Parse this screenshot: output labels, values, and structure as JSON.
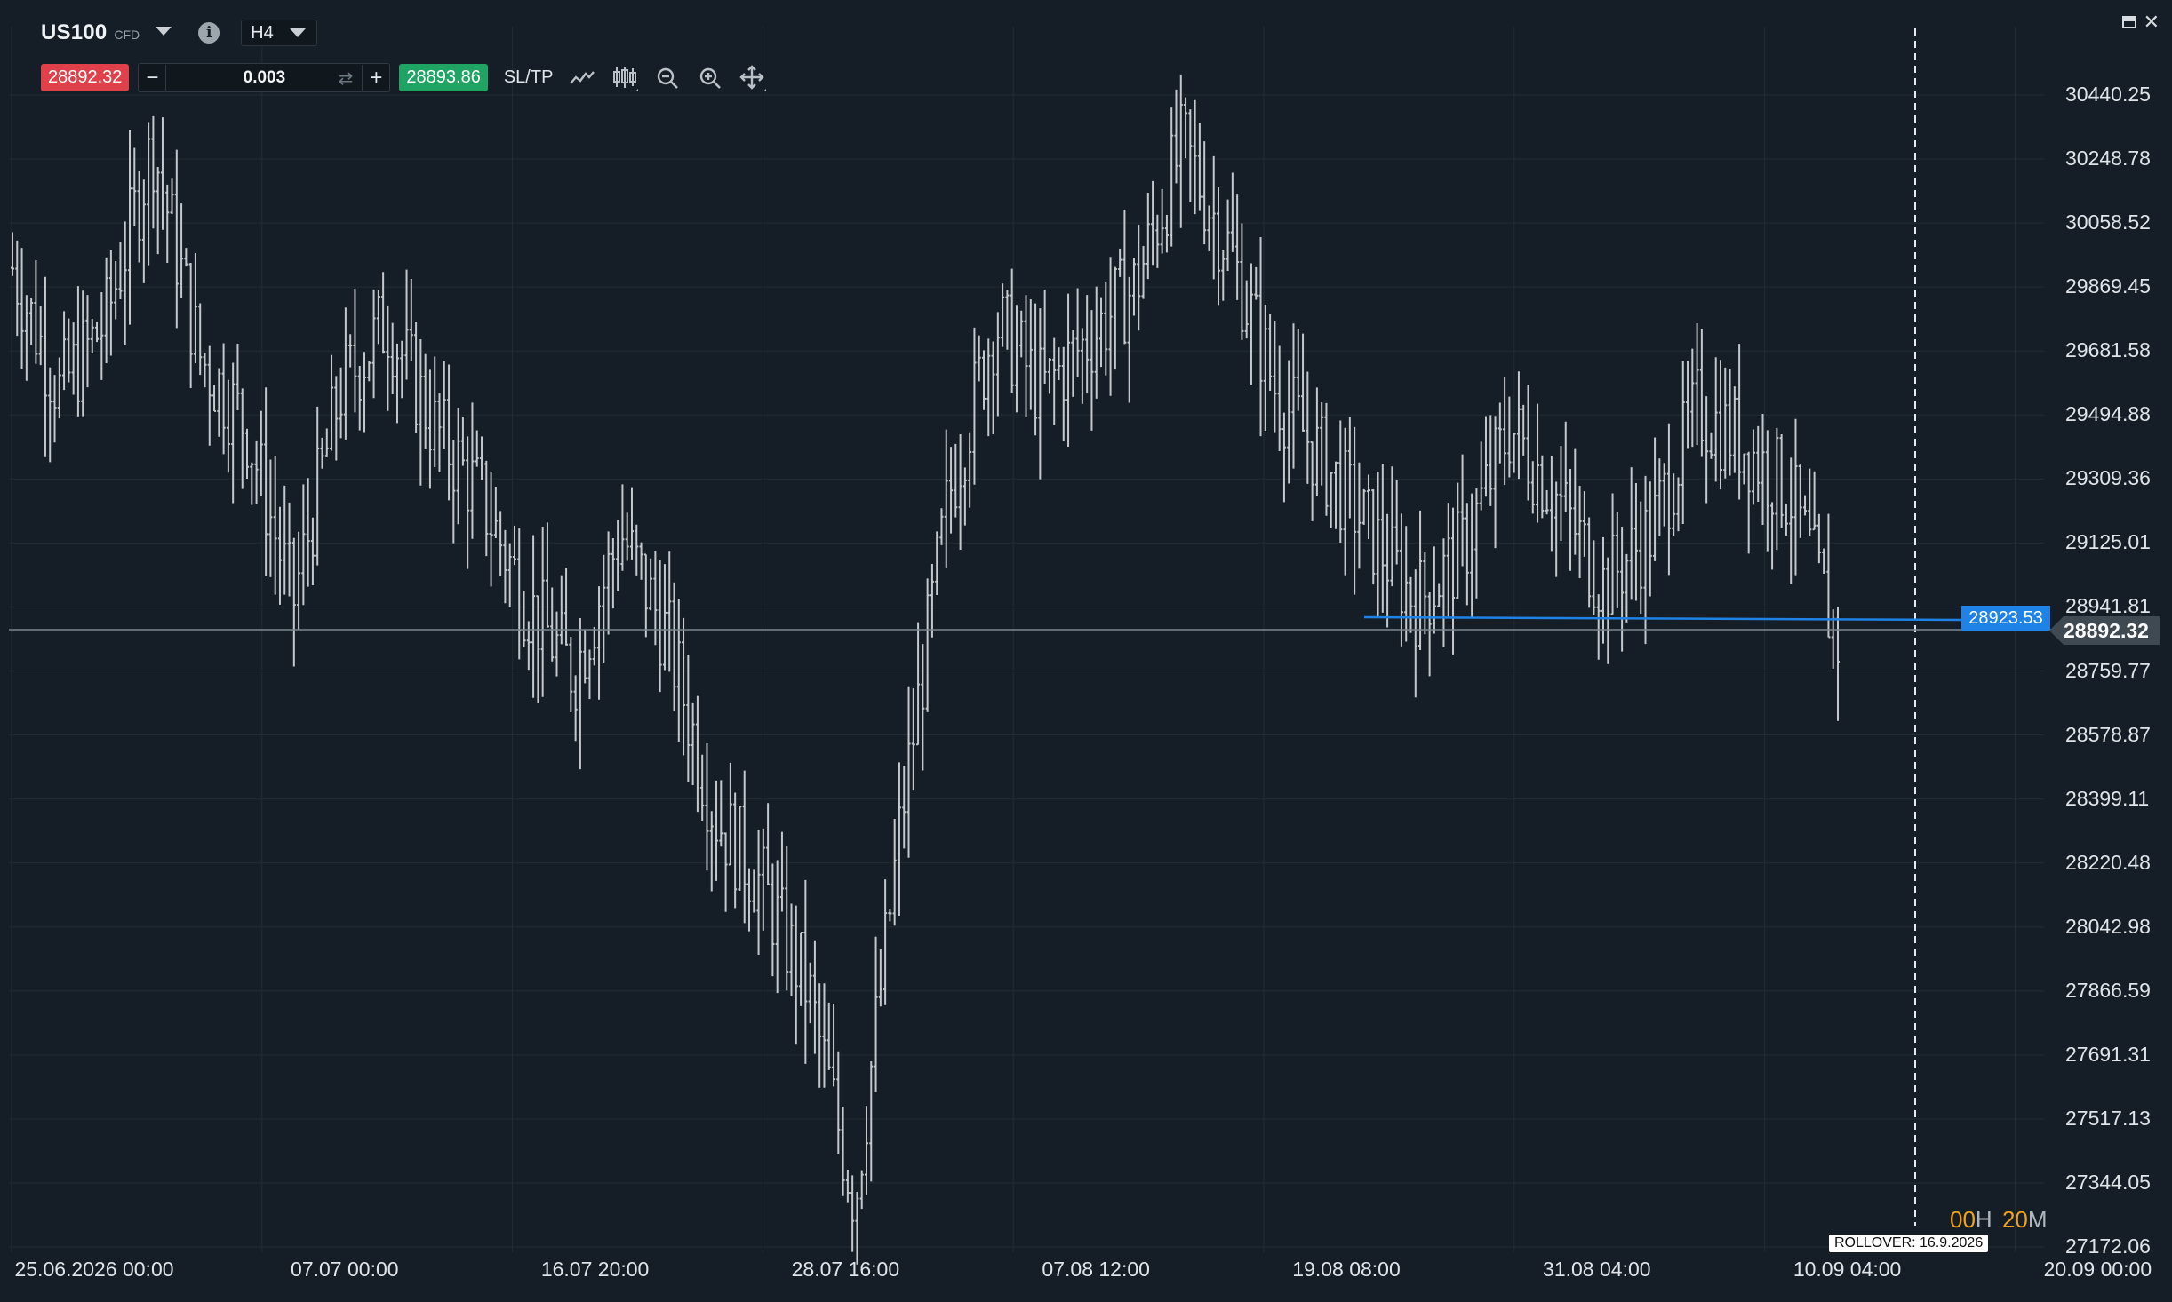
{
  "header": {
    "symbol": "US100",
    "instrument_type": "CFD",
    "timeframe": "H4",
    "sell_price": "28892.32",
    "buy_price": "28893.86",
    "volume": "0.003",
    "sltp_label": "SL/TP",
    "icons": [
      "chevron-down-icon",
      "info-icon",
      "line-chart-icon",
      "bar-chart-icon",
      "zoom-out-icon",
      "zoom-in-icon",
      "move-icon",
      "minimize-icon",
      "close-icon"
    ]
  },
  "price_axis_labels": [
    "30440.25",
    "30248.78",
    "30058.52",
    "29869.45",
    "29681.58",
    "29494.88",
    "29309.36",
    "29125.01",
    "28941.81",
    "28759.77",
    "28578.87",
    "28399.11",
    "28220.48",
    "28042.98",
    "27866.59",
    "27691.31",
    "27517.13",
    "27344.05",
    "27172.06"
  ],
  "time_axis_labels": [
    "25.06.2026 00:00",
    "07.07 00:00",
    "16.07 20:00",
    "28.07 16:00",
    "07.08 12:00",
    "19.08 08:00",
    "31.08 04:00",
    "10.09 04:00",
    "20.09 00:00"
  ],
  "current_price_tag": "28892.32",
  "level_line_tag": "28923.53",
  "countdown": {
    "hours": "00",
    "h_unit": "H",
    "minutes": "20",
    "m_unit": "M"
  },
  "rollover_label": "ROLLOVER: 16.9.2026",
  "colors": {
    "background": "#151e26",
    "candle": "#c4c8cc",
    "grid": "#222c35",
    "level_line": "#1e82e6",
    "sell": "#e0404a",
    "buy": "#1fa463",
    "timer": "#f0a11c"
  },
  "chart_data": {
    "type": "ohlc",
    "symbol": "US100",
    "timeframe": "H4",
    "x": [
      "2026-06-25",
      "2026-06-27",
      "2026-06-29",
      "2026-07-01",
      "2026-07-03",
      "2026-07-05",
      "2026-07-07",
      "2026-07-09",
      "2026-07-11",
      "2026-07-13",
      "2026-07-15",
      "2026-07-17",
      "2026-07-19",
      "2026-07-21",
      "2026-07-23",
      "2026-07-25",
      "2026-07-27",
      "2026-07-29",
      "2026-07-31",
      "2026-08-02",
      "2026-08-04",
      "2026-08-06",
      "2026-08-08",
      "2026-08-10",
      "2026-08-12",
      "2026-08-14",
      "2026-08-16",
      "2026-08-18",
      "2026-08-20",
      "2026-08-22",
      "2026-08-24",
      "2026-08-26",
      "2026-08-28",
      "2026-08-30",
      "2026-09-01",
      "2026-09-03",
      "2026-09-05",
      "2026-09-07",
      "2026-09-09",
      "2026-09-11"
    ],
    "close": [
      29950,
      29600,
      29800,
      30300,
      29700,
      29500,
      29000,
      29600,
      29800,
      29500,
      29300,
      29000,
      28800,
      29200,
      28900,
      28400,
      28200,
      27900,
      27300,
      28400,
      29300,
      29800,
      29600,
      29750,
      29900,
      30300,
      30000,
      29600,
      29400,
      29200,
      29000,
      29150,
      29500,
      29300,
      29050,
      29200,
      29550,
      29450,
      29300,
      28892.32
    ],
    "ylim": [
      27172.06,
      30440.25
    ],
    "reference_level": 28923.53,
    "last_price": 28892.32
  }
}
